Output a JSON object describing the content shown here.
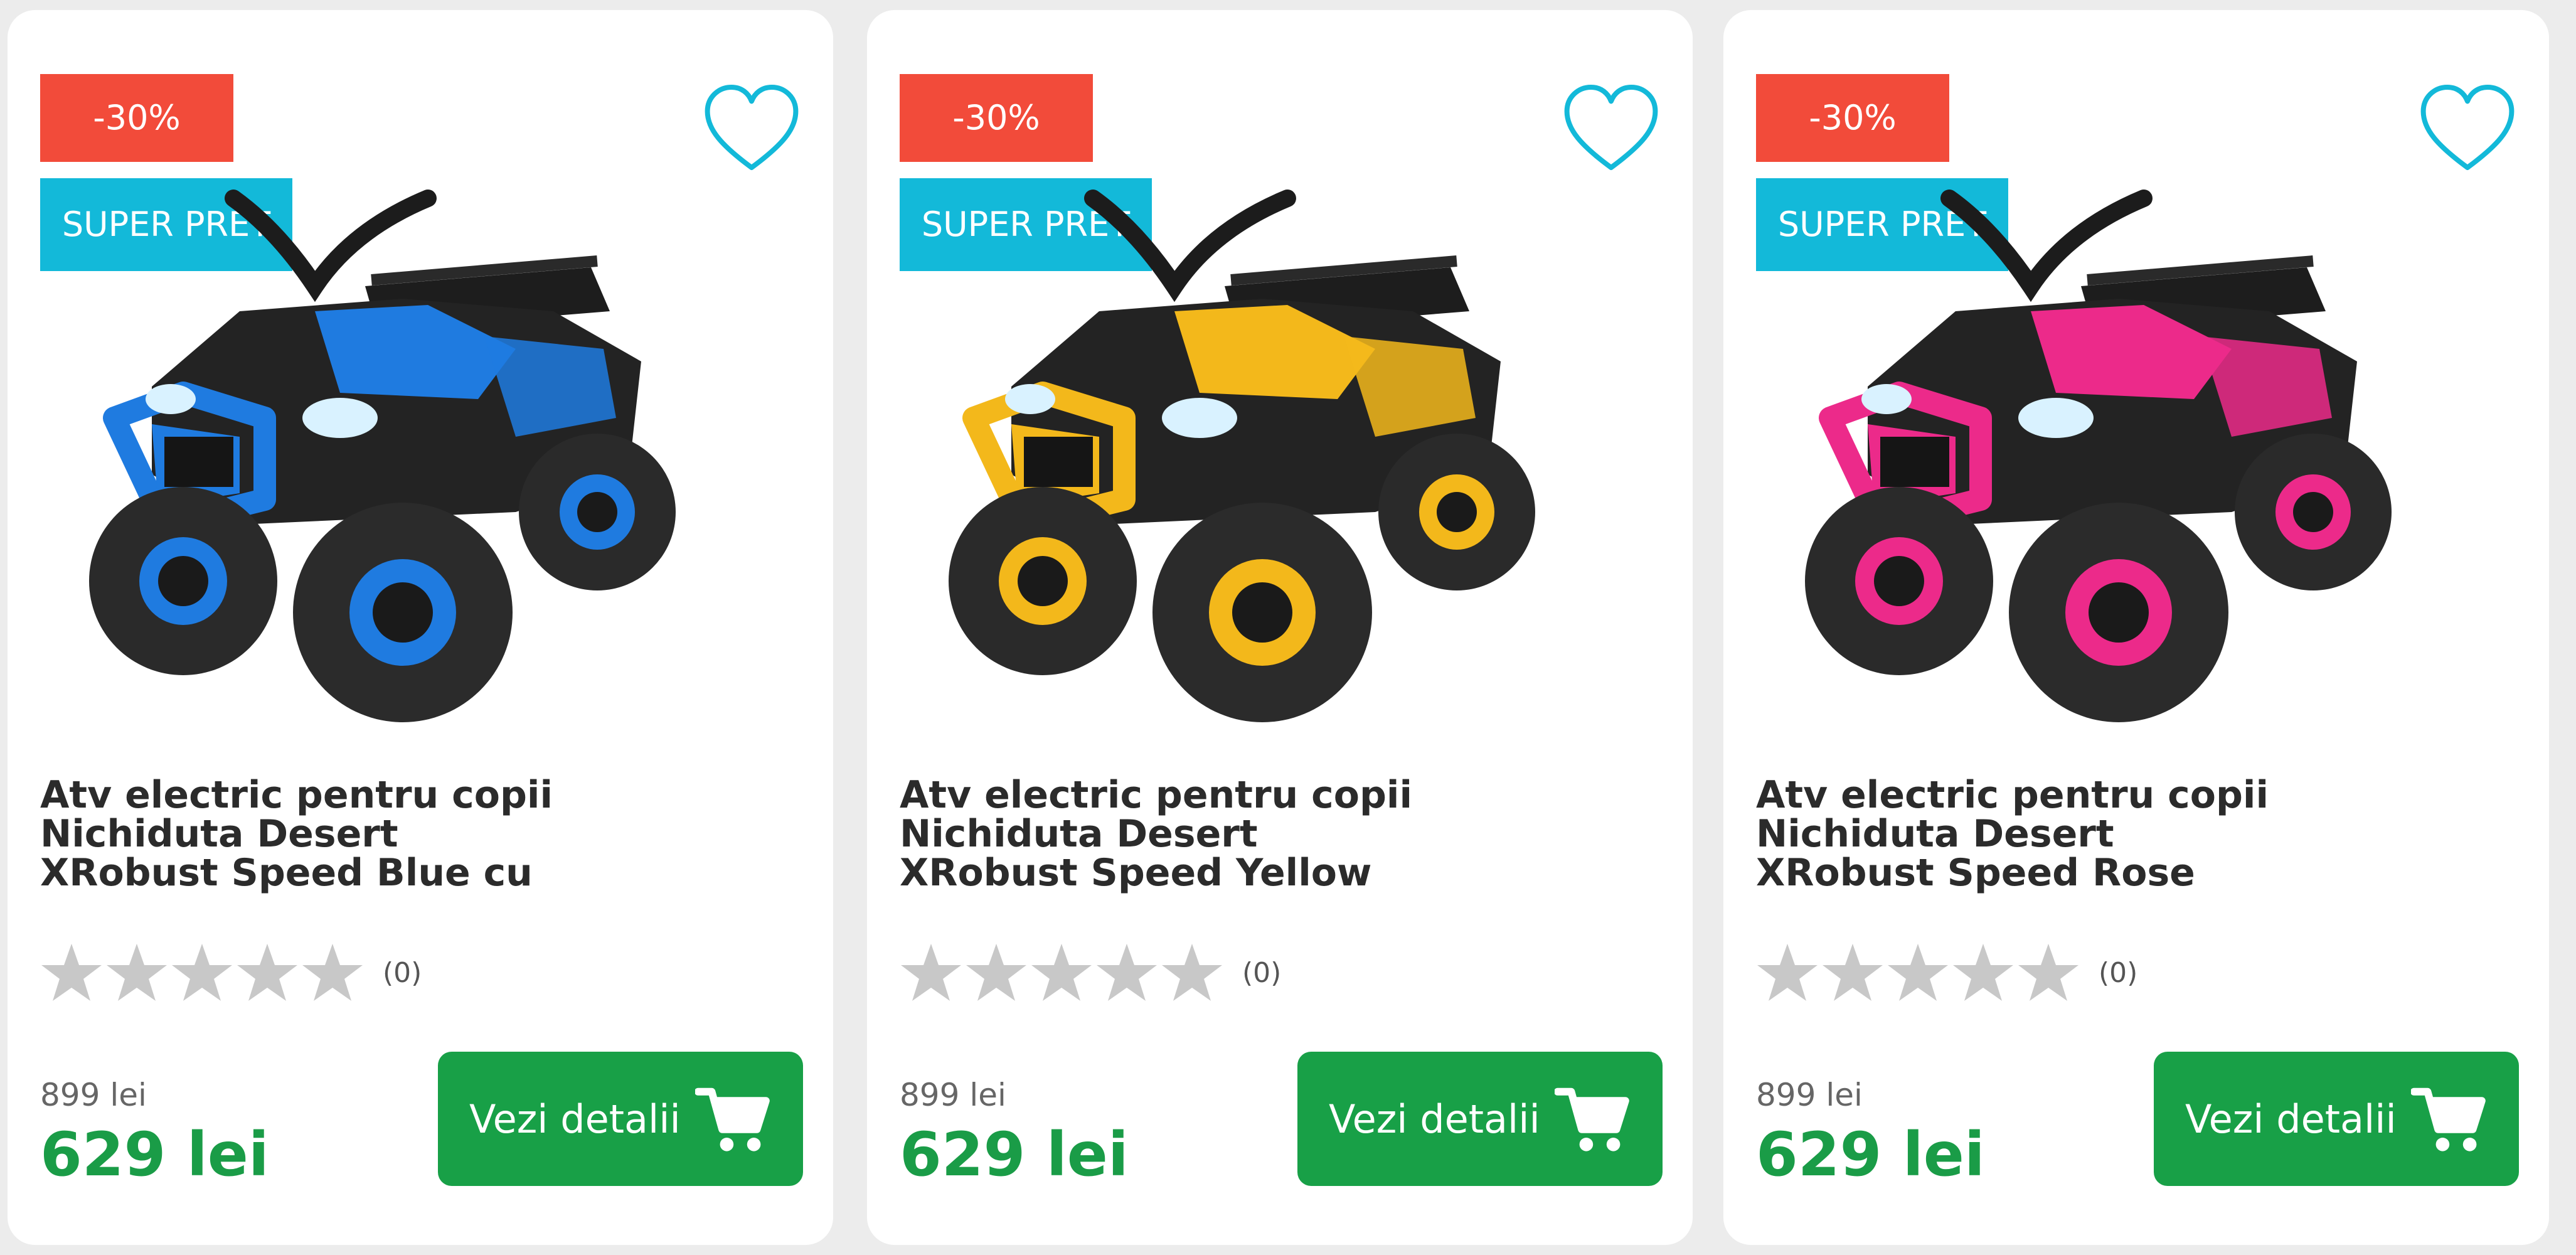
{
  "theme": {
    "discount_color": "#f24b3a",
    "label_color": "#13b9d9",
    "cta_color": "#18a047",
    "price_color": "#1a9c47",
    "heart_color": "#13b9d9",
    "star_color": "#c8c8c8"
  },
  "products": [
    {
      "discount": "-30%",
      "label": "SUPER PRET",
      "title": "Atv electric pentru copii\nNichiduta Desert\nXRobust Speed Blue cu",
      "rating": 0,
      "rating_count": "(0)",
      "old_price": "899 lei",
      "price": "629 lei",
      "cta": "Vezi detalii",
      "accent": "#1f7be0"
    },
    {
      "discount": "-30%",
      "label": "SUPER PRET",
      "title": "Atv electric pentru copii\nNichiduta Desert\nXRobust Speed Yellow",
      "rating": 0,
      "rating_count": "(0)",
      "old_price": "899 lei",
      "price": "629 lei",
      "cta": "Vezi detalii",
      "accent": "#f3b81b"
    },
    {
      "discount": "-30%",
      "label": "SUPER PRET",
      "title": "Atv electric pentru copii\nNichiduta Desert\nXRobust Speed Rose",
      "rating": 0,
      "rating_count": "(0)",
      "old_price": "899 lei",
      "price": "629 lei",
      "cta": "Vezi detalii",
      "accent": "#ec2a8a"
    }
  ]
}
